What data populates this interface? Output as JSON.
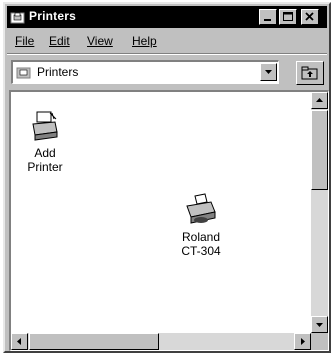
{
  "window": {
    "title": "Printers"
  },
  "menu": [
    {
      "label": "File"
    },
    {
      "label": "Edit"
    },
    {
      "label": "View"
    },
    {
      "label": "Help"
    }
  ],
  "address": {
    "value": "Printers"
  },
  "items": [
    {
      "label_lines": [
        "Add Printer"
      ],
      "icon": "add-printer-icon"
    },
    {
      "label_lines": [
        "Roland",
        "CT-304"
      ],
      "icon": "printer-icon"
    }
  ]
}
